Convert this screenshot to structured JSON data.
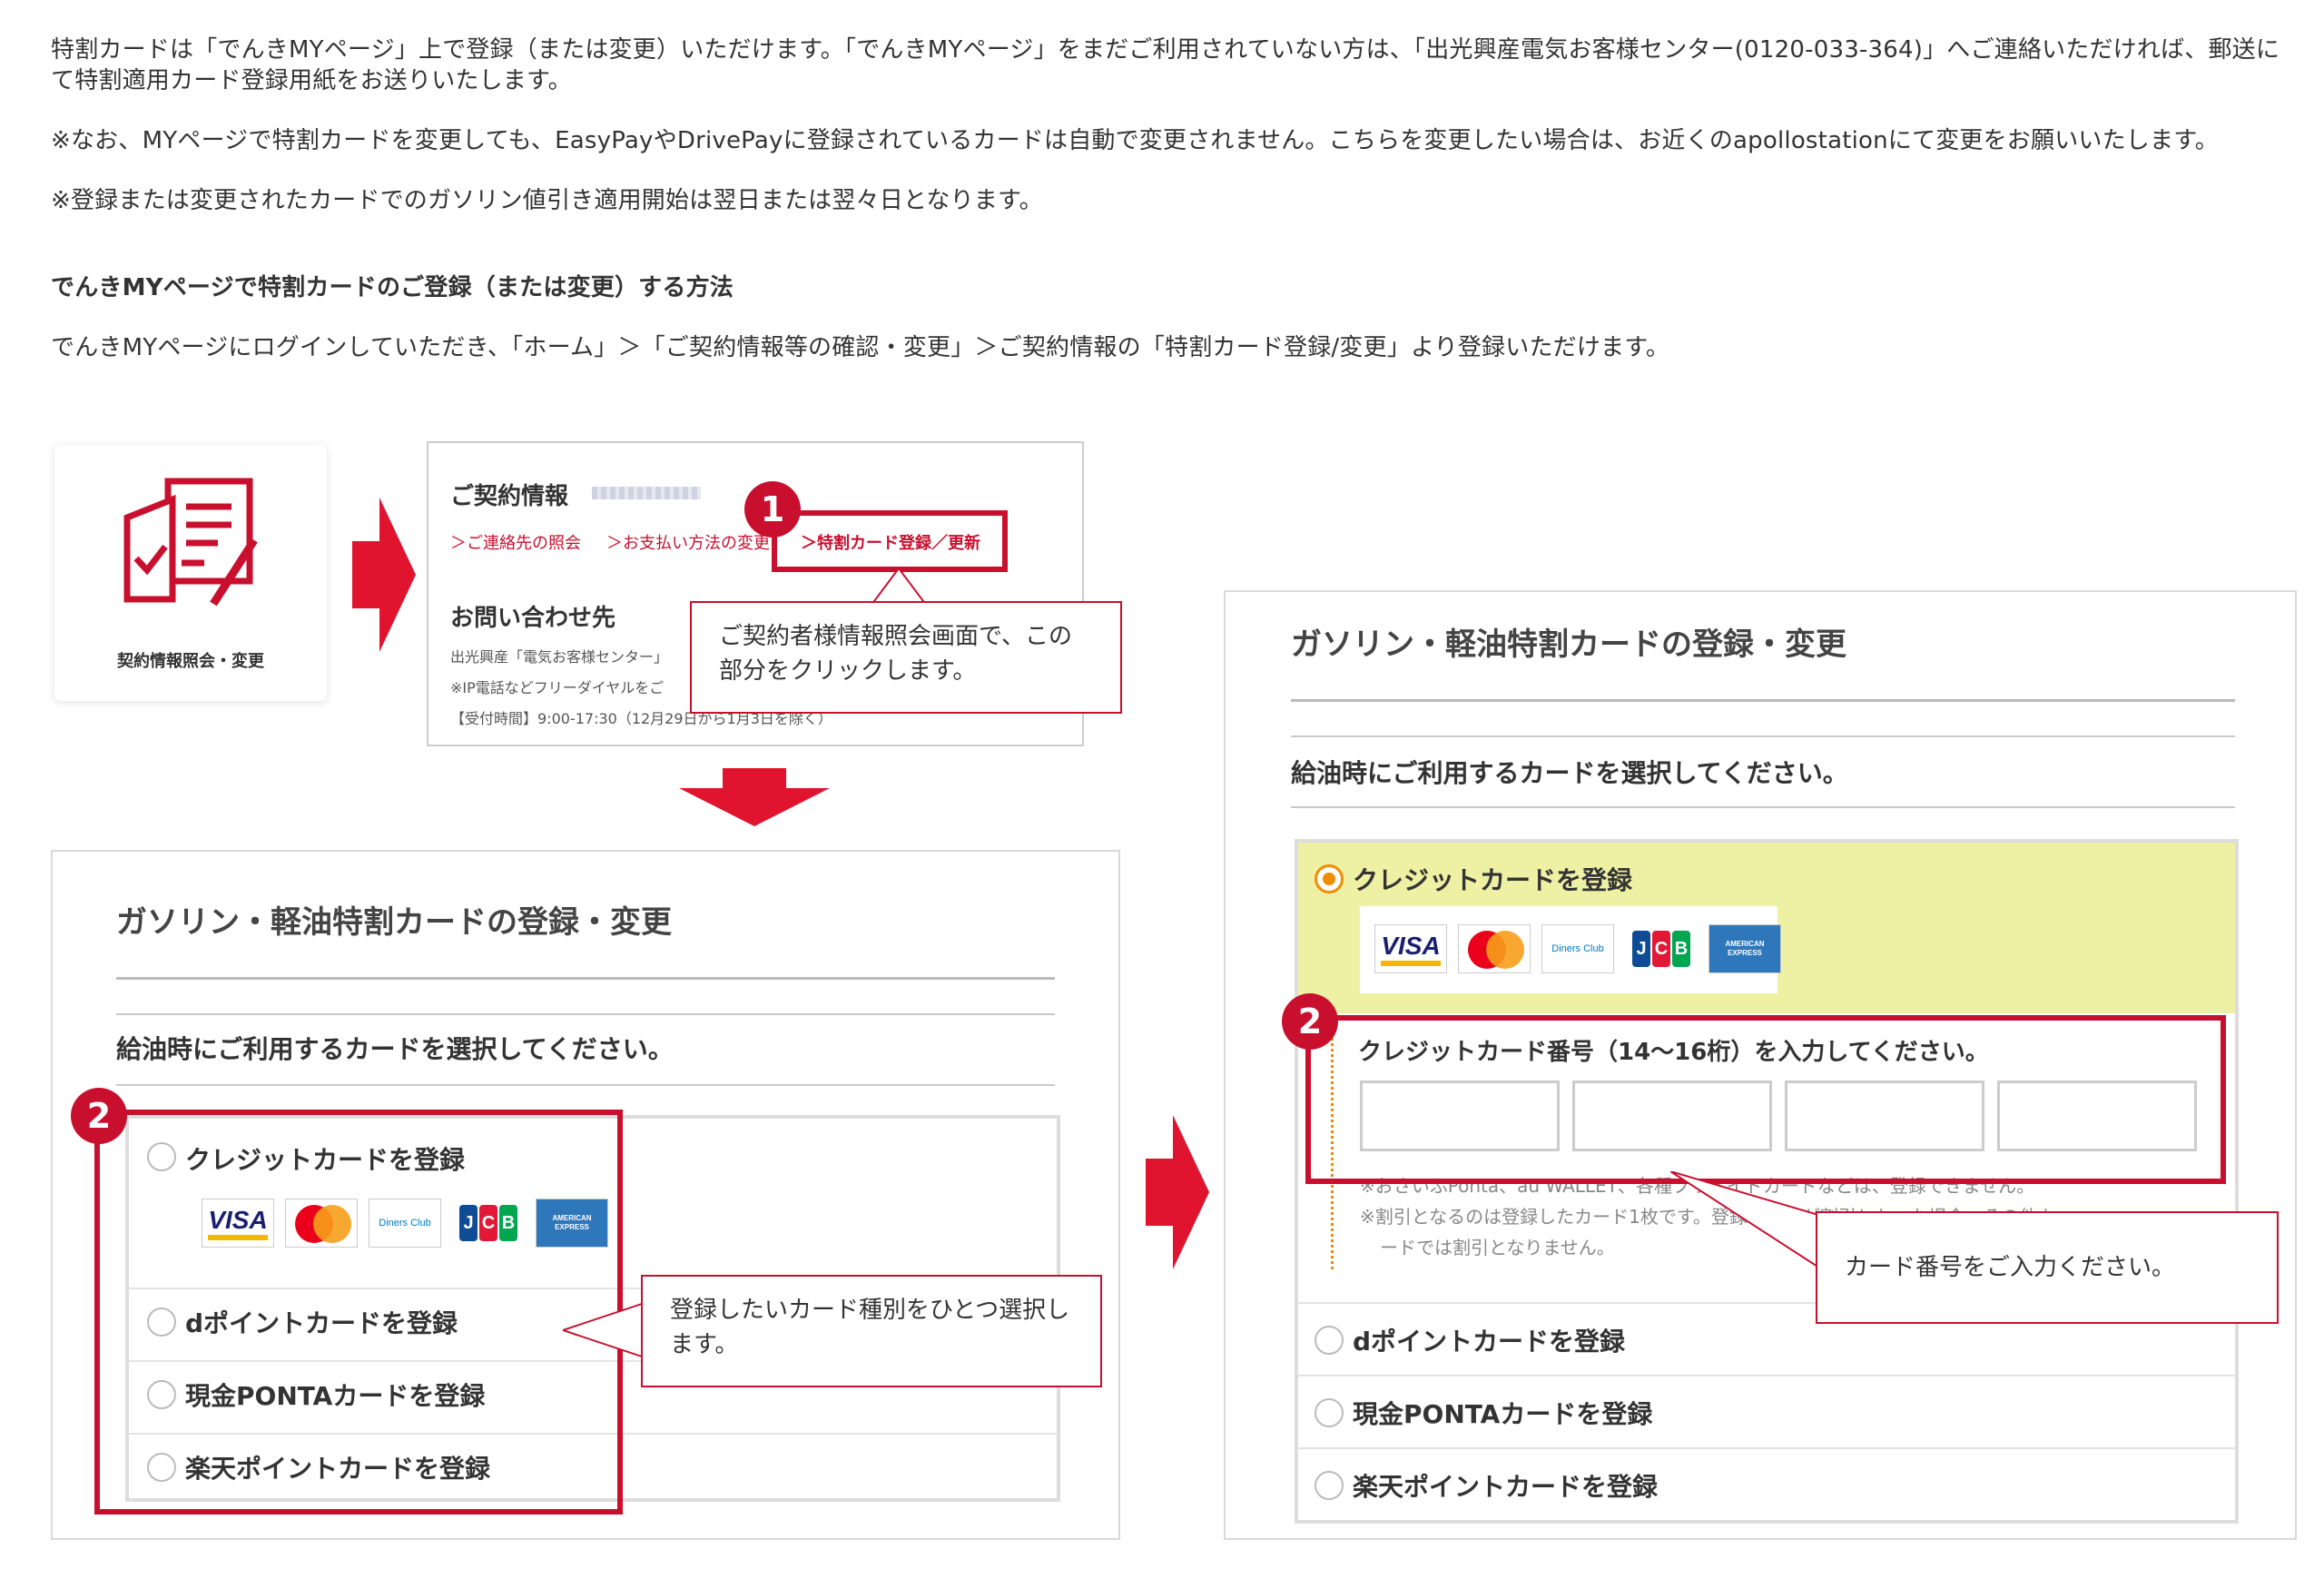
{
  "intro": {
    "p1": "特割カードは「でんきMYページ」上で登録（または変更）いただけます。「でんきMYページ」をまだご利用されていない方は、「出光興産電気お客様センター(0120-033-364)」へご連絡いただければ、郵送にて特割適用カード登録用紙をお送りいたします。",
    "p2": "※なお、MYページで特割カードを変更しても、EasyPayやDrivePayに登録されているカードは自動で変更されません。こちらを変更したい場合は、お近くのapollostationにて変更をお願いいたします。",
    "p3": "※登録または変更されたカードでのガソリン値引き適用開始は翌日または翌々日となります。",
    "heading": "でんきMYページで特割カードのご登録（または変更）する方法",
    "p4": "でんきMYページにログインしていただき、「ホーム」＞「ご契約情報等の確認・変更」＞ご契約情報の「特割カード登録/変更」より登録いただけます。"
  },
  "icon_tile": {
    "label": "契約情報照会・変更"
  },
  "contract_panel": {
    "title": "ご契約情報",
    "links": [
      "＞ご連絡先の照会",
      "＞お支払い方法の変更",
      "＞特割カード登録／更新"
    ],
    "inquiry_title": "お問い合わせ先",
    "inquiry_line1": "出光興産「電気お客様センター」",
    "inquiry_line2": "※IP電話などフリーダイヤルをご",
    "hours": "【受付時間】9:00-17:30（12月29日から1月3日を除く）"
  },
  "steps": {
    "one": "1",
    "two": "2"
  },
  "callouts": {
    "c1": "ご契約者様情報照会画面で、この部分をクリックします。",
    "c2": "登録したいカード種別をひとつ選択します。",
    "c3": "カード番号をご入力ください。"
  },
  "card_form": {
    "title": "ガソリン・軽油特割カードの登録・変更",
    "subtitle": "給油時にご利用するカードを選択してください。",
    "options": [
      "クレジットカードを登録",
      "dポイントカードを登録",
      "現金PONTAカードを登録",
      "楽天ポイントカードを登録"
    ],
    "card_number_label": "クレジットカード番号（14〜16桁）を入力してください。",
    "note1": "※おさいふPonta、au WALLET、各種プリペイドカードなどは、登録できません。",
    "note2": "※割引となるのは登録したカード1枚です。登録カードが割引となった場合、その他カ",
    "note3": "ードでは割引となりません。"
  },
  "brands": {
    "visa": "VISA",
    "diners": "Diners Club",
    "jcb": [
      "J",
      "C",
      "B"
    ],
    "amex": "AMERICAN EXPRESS"
  },
  "colors": {
    "red": "#c8102e",
    "orange": "#f08c00",
    "highlight": "#eef0a4",
    "border": "#d9d9d9"
  }
}
